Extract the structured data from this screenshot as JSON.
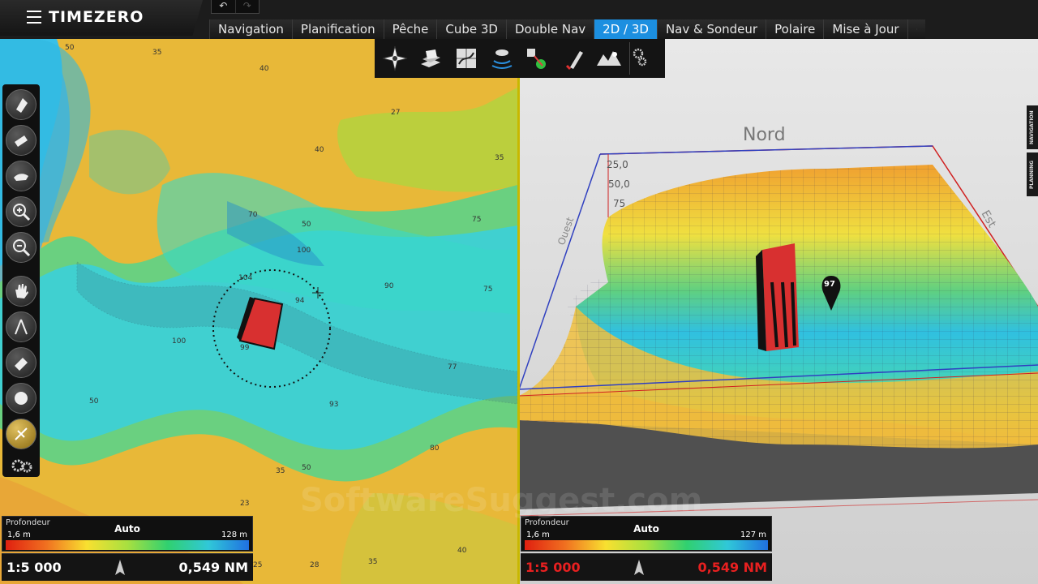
{
  "brand": {
    "title": "TIMEZERO"
  },
  "tabs": [
    {
      "label": "Navigation"
    },
    {
      "label": "Planification"
    },
    {
      "label": "Pêche"
    },
    {
      "label": "Cube 3D"
    },
    {
      "label": "Double Nav"
    },
    {
      "label": "2D / 3D"
    },
    {
      "label": "Nav & Sondeur"
    },
    {
      "label": "Polaire"
    },
    {
      "label": "Mise à Jour"
    }
  ],
  "active_tab": "2D / 3D",
  "map2d": {
    "depth_labels": [
      "50",
      "35",
      "40",
      "27",
      "40",
      "35",
      "70",
      "50",
      "75",
      "100",
      "104",
      "94",
      "90",
      "75",
      "100",
      "99",
      "77",
      "50",
      "93",
      "80",
      "35",
      "50",
      "23",
      "25",
      "28",
      "35",
      "40"
    ],
    "target_label": "97"
  },
  "map3d": {
    "north_label": "Nord",
    "west_label": "Ouest",
    "east_label": "Est",
    "depth_scale": [
      "25,0",
      "50,0",
      "75"
    ],
    "marker_label": "97"
  },
  "legend2d": {
    "title": "Profondeur",
    "mode": "Auto",
    "min": "1,6 m",
    "max": "128 m"
  },
  "legend3d": {
    "title": "Profondeur",
    "mode": "Auto",
    "min": "1,6 m",
    "max": "127 m"
  },
  "scale2d": {
    "scale": "1:5 000",
    "distance": "0,549 NM"
  },
  "scale3d": {
    "scale": "1:5 000",
    "distance": "0,549 NM"
  },
  "side_tabs": [
    "NAVIGATION",
    "PLANNING"
  ],
  "watermark": "SoftwareSuggest.com"
}
